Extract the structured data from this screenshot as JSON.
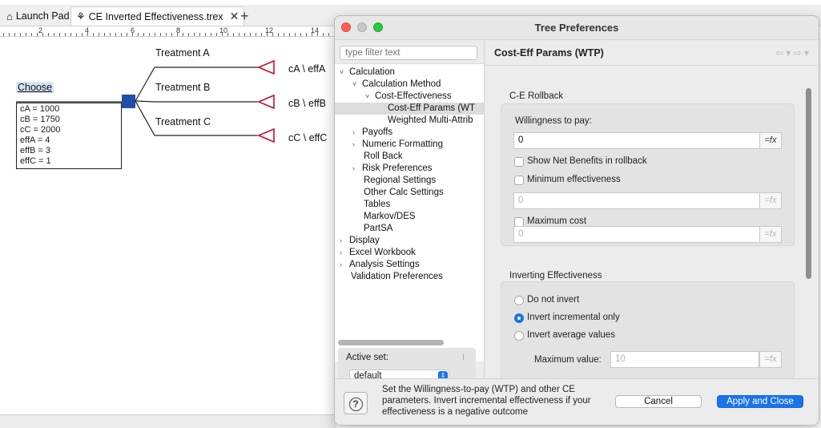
{
  "tabs": [
    {
      "label": "Launch Pad",
      "icon": "home-icon"
    },
    {
      "label": "CE Inverted Effectiveness.trex",
      "icon": "tree-file-icon"
    }
  ],
  "ruler": {
    "numbers": [
      "2",
      "4",
      "6",
      "8",
      "10",
      "12",
      "14"
    ]
  },
  "tree": {
    "decision_label": "Choose",
    "variables": [
      "cA = 1000",
      "cB = 1750",
      "cC = 2000",
      "effA = 4",
      "effB = 3",
      "effC = 1"
    ],
    "branches": [
      {
        "name": "Treatment A",
        "payoff": "cA \\ effA"
      },
      {
        "name": "Treatment B",
        "payoff": "cB \\ effB"
      },
      {
        "name": "Treatment C",
        "payoff": "cC \\ effC"
      }
    ]
  },
  "dialog": {
    "title": "Tree Preferences",
    "filter_placeholder": "type filter text",
    "nav": [
      {
        "label": "Calculation",
        "twisty": "˅"
      },
      {
        "label": "Calculation Method",
        "twisty": "˅"
      },
      {
        "label": "Cost-Effectiveness",
        "twisty": "˅"
      },
      {
        "label": "Cost-Eff Params (WT",
        "twisty": ""
      },
      {
        "label": "Weighted Multi-Attrib",
        "twisty": ""
      },
      {
        "label": "Payoffs",
        "twisty": "›"
      },
      {
        "label": "Numeric Formatting",
        "twisty": "›"
      },
      {
        "label": "Roll Back",
        "twisty": ""
      },
      {
        "label": "Risk Preferences",
        "twisty": "›"
      },
      {
        "label": "Regional Settings",
        "twisty": ""
      },
      {
        "label": "Other Calc Settings",
        "twisty": ""
      },
      {
        "label": "Tables",
        "twisty": ""
      },
      {
        "label": "Markov/DES",
        "twisty": ""
      },
      {
        "label": "PartSA",
        "twisty": ""
      },
      {
        "label": "Display",
        "twisty": "›"
      },
      {
        "label": "Excel Workbook",
        "twisty": "›"
      },
      {
        "label": "Analysis Settings",
        "twisty": "›"
      },
      {
        "label": "Validation Preferences",
        "twisty": ""
      }
    ],
    "active_set_label": "Active set:",
    "active_set_value": "default",
    "page_title": "Cost-Eff Params (WTP)",
    "ce_rollback": {
      "section": "C-E Rollback",
      "wtp_label": "Willingness to pay:",
      "wtp_value": "0",
      "fx": "=fx",
      "show_net_benefits": "Show Net Benefits in rollback",
      "min_eff": "Minimum effectiveness",
      "min_eff_value": "0",
      "max_cost": "Maximum cost",
      "max_cost_value": "0"
    },
    "inverting": {
      "section": "Inverting Effectiveness",
      "options": [
        "Do not invert",
        "Invert incremental only",
        "Invert average values"
      ],
      "selected_index": 1,
      "max_value_label": "Maximum value:",
      "max_value": "10"
    },
    "help_text": "Set the Willingness-to-pay (WTP) and other CE parameters. Invert incremental effectiveness if your effectiveness is a negative outcome",
    "cancel": "Cancel",
    "apply": "Apply and Close"
  },
  "colors": {
    "accent": "#1a73e8",
    "decision_node": "#1f4fa8",
    "terminal_node": "#c8102e"
  }
}
